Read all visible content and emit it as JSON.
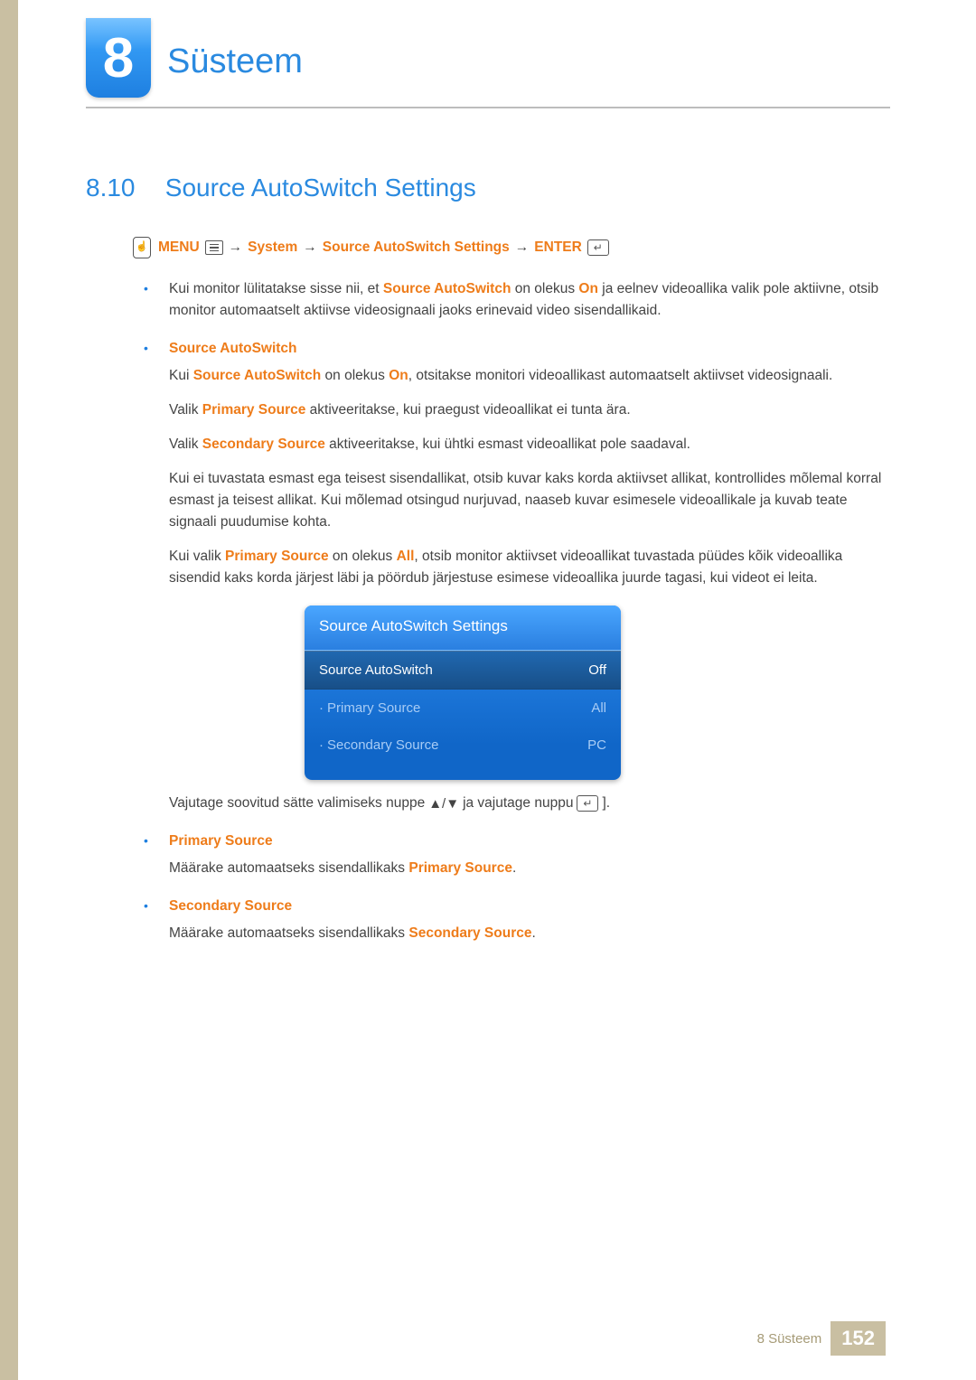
{
  "chapter": {
    "number": "8",
    "title": "Süsteem"
  },
  "section": {
    "number": "8.10",
    "title": "Source AutoSwitch Settings"
  },
  "nav": {
    "menu": "MENU",
    "arrow": "→",
    "system": "System",
    "path": "Source AutoSwitch Settings",
    "enter": "ENTER"
  },
  "intro": {
    "pre": "Kui monitor lülitatakse sisse nii, et ",
    "term1": "Source AutoSwitch",
    "mid1": " on olekus ",
    "term2": "On",
    "post": " ja eelnev videoallika valik pole aktiivne, otsib monitor automaatselt aktiivse videosignaali jaoks erinevaid video sisendallikaid."
  },
  "bullets": {
    "b1_title": "Source AutoSwitch",
    "b1_p1_pre": "Kui ",
    "b1_p1_t1": "Source AutoSwitch",
    "b1_p1_mid": " on olekus ",
    "b1_p1_t2": "On",
    "b1_p1_post": ", otsitakse monitori videoallikast automaatselt aktiivset videosignaali.",
    "b1_p2_pre": "Valik ",
    "b1_p2_t": "Primary Source",
    "b1_p2_post": " aktiveeritakse, kui praegust videoallikat ei tunta ära.",
    "b1_p3_pre": "Valik ",
    "b1_p3_t": "Secondary Source",
    "b1_p3_post": " aktiveeritakse, kui ühtki esmast videoallikat pole saadaval.",
    "b1_p4": "Kui ei tuvastata esmast ega teisest sisendallikat, otsib kuvar kaks korda aktiivset allikat, kontrollides mõlemal korral esmast ja teisest allikat. Kui mõlemad otsingud nurjuvad, naaseb kuvar esimesele videoallikale ja kuvab teate signaali puudumise kohta.",
    "b1_p5_pre": "Kui valik ",
    "b1_p5_t1": "Primary Source",
    "b1_p5_mid": " on olekus ",
    "b1_p5_t2": "All",
    "b1_p5_post": ", otsib monitor aktiivset videoallikat tuvastada püüdes kõik videoallika sisendid kaks korda järjest läbi ja pöördub järjestuse esimese videoallika juurde tagasi, kui videot ei leita.",
    "b2_title": "Primary Source",
    "b2_p1_pre": "Määrake automaatseks sisendallikaks ",
    "b2_p1_t": "Primary Source",
    "b2_p1_post": ".",
    "b3_title": "Secondary Source",
    "b3_p1_pre": "Määrake automaatseks sisendallikaks ",
    "b3_p1_t": "Secondary Source",
    "b3_p1_post": "."
  },
  "panel": {
    "title": "Source AutoSwitch Settings",
    "row1_label": "Source AutoSwitch",
    "row1_value": "Off",
    "row2_label": "Primary Source",
    "row2_value": "All",
    "row3_label": "Secondary Source",
    "row3_value": "PC"
  },
  "after_panel": {
    "pre": "Vajutage soovitud sätte valimiseks nuppe ",
    "updown": "▲/▼",
    "mid": " ja vajutage nuppu ",
    "bracket_close": "]."
  },
  "footer": {
    "chapter": "8 Süsteem",
    "page": "152"
  }
}
